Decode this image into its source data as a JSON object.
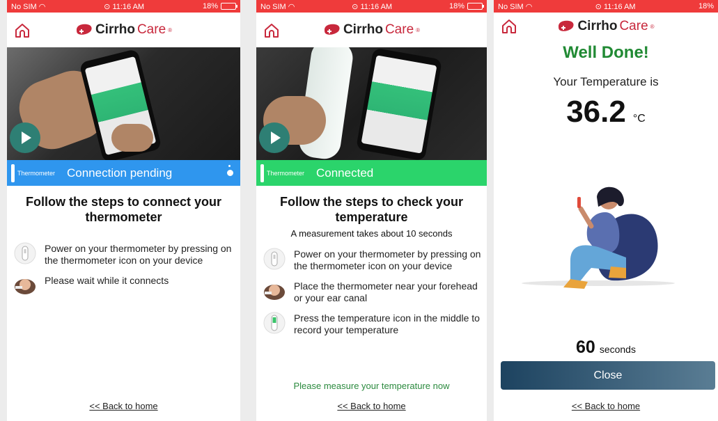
{
  "status_bar": {
    "carrier": "No SIM",
    "time": "11:16 AM",
    "battery": "18%"
  },
  "brand": {
    "part1": "Cirrho",
    "part2": "Care",
    "reg": "®"
  },
  "screens": [
    {
      "device_tag": "Thermometer",
      "connection_status": "Connection pending",
      "title": "Follow the steps to connect your thermometer",
      "steps": [
        {
          "icon": "thermometer-icon",
          "text": "Power on your thermometer by pressing on the thermometer icon on your device"
        },
        {
          "icon": "person-icon",
          "text": "Please wait while it connects"
        }
      ],
      "back_link": "<< Back to home"
    },
    {
      "device_tag": "Thermometer",
      "connection_status": "Connected",
      "title": "Follow the steps to check your temperature",
      "subtitle": "A measurement takes about 10 seconds",
      "steps": [
        {
          "icon": "thermometer-icon",
          "text": "Power on your thermometer by pressing on the thermometer icon on your device"
        },
        {
          "icon": "person-icon",
          "text": "Place the thermometer near your forehead or your ear canal"
        },
        {
          "icon": "thermometer-green-icon",
          "text": "Press the temperature icon in the middle to record your temperature"
        }
      ],
      "prompt": "Please measure your temperature now",
      "back_link": "<< Back to home"
    },
    {
      "heading": "Well Done!",
      "temp_label": "Your Temperature is",
      "temp_value": "36.2",
      "temp_unit": "°C",
      "countdown_value": "60",
      "countdown_unit": "seconds",
      "close_label": "Close",
      "back_link": "<< Back to home"
    }
  ],
  "colors": {
    "status_bar": "#ef3b3b",
    "conn_pending": "#2f96ee",
    "conn_ok": "#2bd46b",
    "success_text": "#218a34",
    "brand_red": "#c8283c"
  }
}
